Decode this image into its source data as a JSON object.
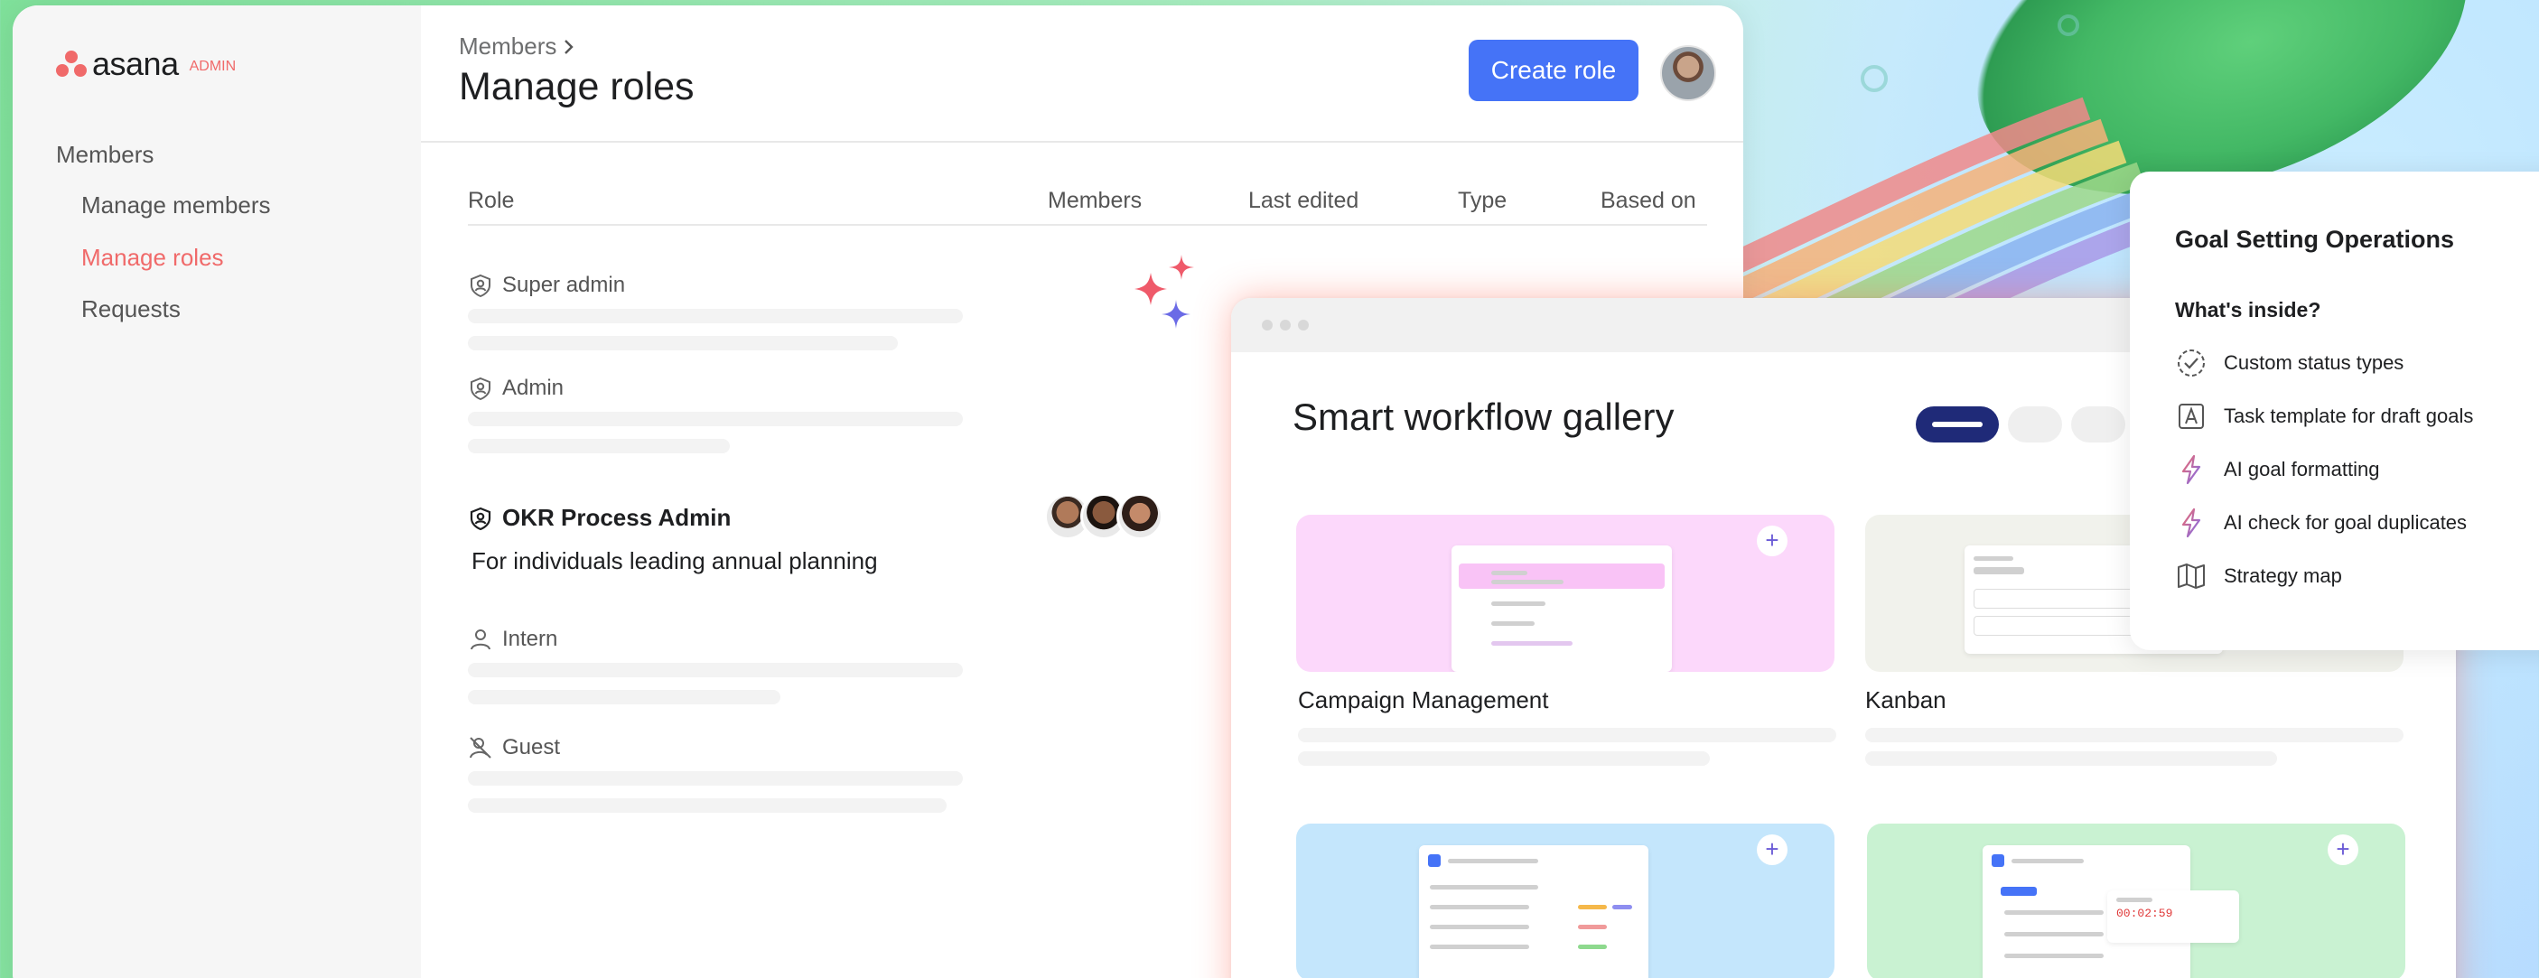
{
  "brand": {
    "wordmark": "asana",
    "badge": "ADMIN"
  },
  "sidebar": {
    "section": "Members",
    "items": [
      {
        "label": "Manage members",
        "active": false
      },
      {
        "label": "Manage roles",
        "active": true
      },
      {
        "label": "Requests",
        "active": false
      }
    ]
  },
  "header": {
    "breadcrumb": "Members",
    "breadcrumb_icon": "chevron-right-icon",
    "title": "Manage roles",
    "create_button": "Create role"
  },
  "table": {
    "columns": [
      "Role",
      "Members",
      "Last edited",
      "Type",
      "Based on"
    ],
    "roles": [
      {
        "name": "Super admin",
        "icon": "shield-icon"
      },
      {
        "name": "Admin",
        "icon": "shield-icon"
      },
      {
        "name": "OKR Process Admin",
        "icon": "shield-icon",
        "description": "For individuals leading annual planning"
      },
      {
        "name": "Intern",
        "icon": "person-icon"
      },
      {
        "name": "Guest",
        "icon": "guest-icon"
      }
    ]
  },
  "gallery": {
    "title": "Smart workflow gallery",
    "cards": [
      {
        "label": "Campaign Management",
        "color": "#fcd8fb"
      },
      {
        "label": "Kanban",
        "color": "#f1f2ec"
      },
      {
        "label": "",
        "color": "#c4e6fc"
      },
      {
        "label": "",
        "color": "#c9f2d2"
      }
    ],
    "timer": "00:02:59"
  },
  "goal_panel": {
    "title": "Goal Setting Operations",
    "subtitle": "What's inside?",
    "items": [
      {
        "label": "Custom status types",
        "icon": "dashed-check-circle-icon"
      },
      {
        "label": "Task template for draft goals",
        "icon": "template-letter-a-icon"
      },
      {
        "label": "AI goal formatting",
        "icon": "lightning-icon"
      },
      {
        "label": "AI check for goal duplicates",
        "icon": "lightning-icon"
      },
      {
        "label": "Strategy map",
        "icon": "map-icon"
      }
    ]
  },
  "colors": {
    "accent": "#4573f7",
    "active_nav": "#f06a6a",
    "brand_coral": "#f06a6a"
  }
}
